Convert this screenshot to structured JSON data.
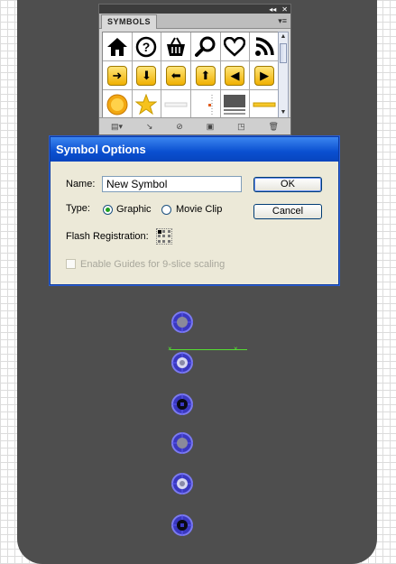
{
  "symbols_panel": {
    "tab_label": "SYMBOLS",
    "topbar_collapse_label": "◂◂",
    "topbar_close_label": "✕",
    "menu_icon_label": "▾≡",
    "rows": [
      [
        "house-icon",
        "question-icon",
        "basket-icon",
        "magnifier-icon",
        "heart-icon",
        "rss-icon"
      ],
      [
        "arrow-right-button",
        "arrow-down-button",
        "arrow-left-button",
        "arrow-up-button",
        "triangle-left-button",
        "triangle-right-button"
      ],
      [
        "orange-circle",
        "star",
        "white-bar",
        "dotted-marker",
        "dark-rectangle",
        "yellow-bar"
      ]
    ],
    "toolbar_icons": [
      "library-icon",
      "place-instance-icon",
      "break-link-icon",
      "symbol-options-icon",
      "new-symbol-icon",
      "delete-icon"
    ]
  },
  "dialog": {
    "title": "Symbol Options",
    "name_label": "Name:",
    "name_value": "New Symbol",
    "type_label": "Type:",
    "type_graphic": "Graphic",
    "type_movie_clip": "Movie Clip",
    "type_selected": "Graphic",
    "registration_label": "Flash Registration:",
    "slice_label": "Enable Guides for 9-slice scaling",
    "ok_label": "OK",
    "cancel_label": "Cancel"
  },
  "stage": {
    "background_color": "#4e4e4e",
    "guide_color": "#55dd33",
    "symbols": [
      "gray-center",
      "white-center",
      "black-center",
      "gray-center",
      "white-center",
      "black-center"
    ]
  }
}
